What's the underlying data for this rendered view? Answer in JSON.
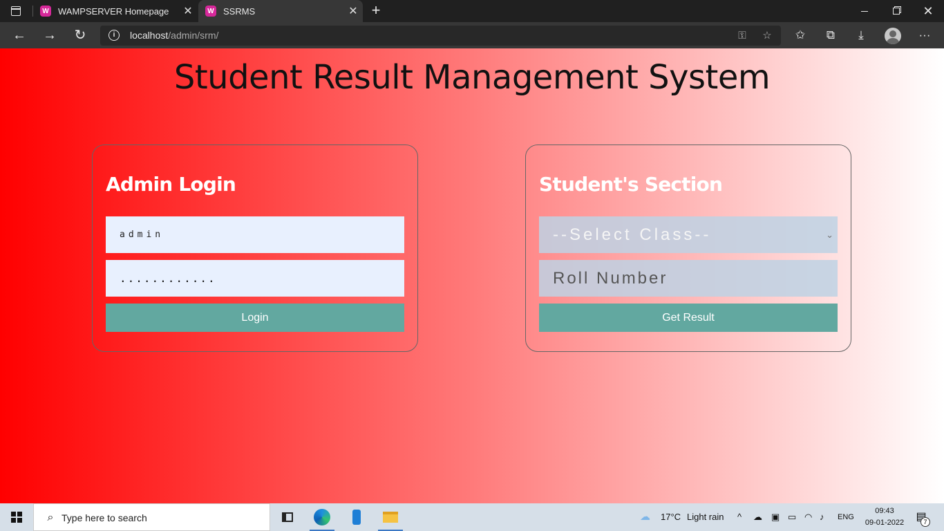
{
  "browser": {
    "tabs": [
      {
        "label": "WAMPSERVER Homepage",
        "favicon": "W"
      },
      {
        "label": "SSRMS",
        "favicon": "W"
      }
    ],
    "url_host": "localhost",
    "url_path": "/admin/srm/"
  },
  "page": {
    "title": "Student Result Management System",
    "admin": {
      "heading": "Admin Login",
      "username_value": "admin",
      "password_value": "............",
      "login_label": "Login"
    },
    "student": {
      "heading": "Student's Section",
      "select_value": "--Select Class--",
      "roll_placeholder": "Roll Number",
      "result_label": "Get Result"
    },
    "colors": {
      "gradient_start": "#ff0000",
      "gradient_end": "#ffffff",
      "button": "#62a8a0"
    }
  },
  "taskbar": {
    "search_placeholder": "Type here to search",
    "weather_temp": "17°C",
    "weather_desc": "Light rain",
    "language": "ENG",
    "time": "09:43",
    "date": "09-01-2022",
    "notification_count": "7"
  }
}
